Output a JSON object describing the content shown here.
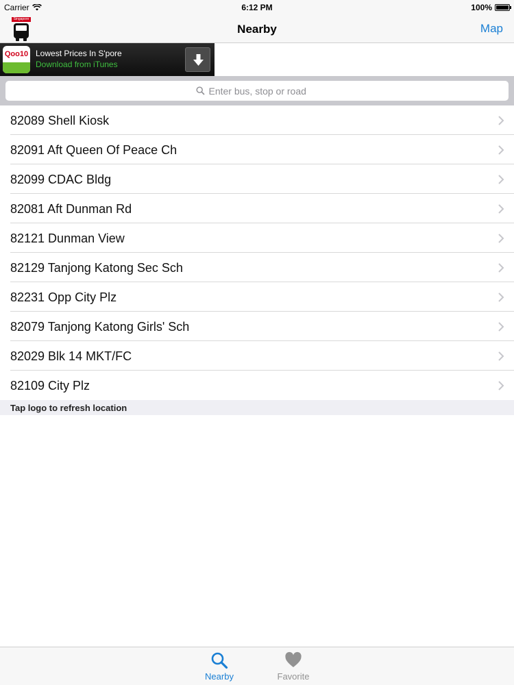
{
  "status_bar": {
    "carrier": "Carrier",
    "time": "6:12 PM",
    "battery": "100%"
  },
  "nav": {
    "title": "Nearby",
    "right_button": "Map",
    "logo_tag": "Singapore"
  },
  "ad": {
    "brand": "Qoo10",
    "title": "Lowest Prices In S'pore",
    "subtitle": "Download from iTunes"
  },
  "search": {
    "placeholder": "Enter bus, stop or road"
  },
  "stops": [
    {
      "label": "82089 Shell Kiosk"
    },
    {
      "label": "82091 Aft Queen Of Peace Ch"
    },
    {
      "label": "82099 CDAC Bldg"
    },
    {
      "label": "82081 Aft Dunman Rd"
    },
    {
      "label": "82121 Dunman View"
    },
    {
      "label": "82129 Tanjong Katong Sec Sch"
    },
    {
      "label": "82231 Opp City Plz"
    },
    {
      "label": "82079 Tanjong Katong Girls' Sch"
    },
    {
      "label": "82029 Blk 14 MKT/FC"
    },
    {
      "label": "82109 City Plz"
    }
  ],
  "footer_hint": "Tap logo to refresh location",
  "tabs": [
    {
      "label": "Nearby",
      "icon": "search-icon",
      "active": true
    },
    {
      "label": "Favorite",
      "icon": "heart-icon",
      "active": false
    }
  ],
  "colors": {
    "accent": "#1a7fd4",
    "inactive": "#929292",
    "ad_subtitle": "#3fbf3f",
    "logo_red": "#d0021b"
  }
}
